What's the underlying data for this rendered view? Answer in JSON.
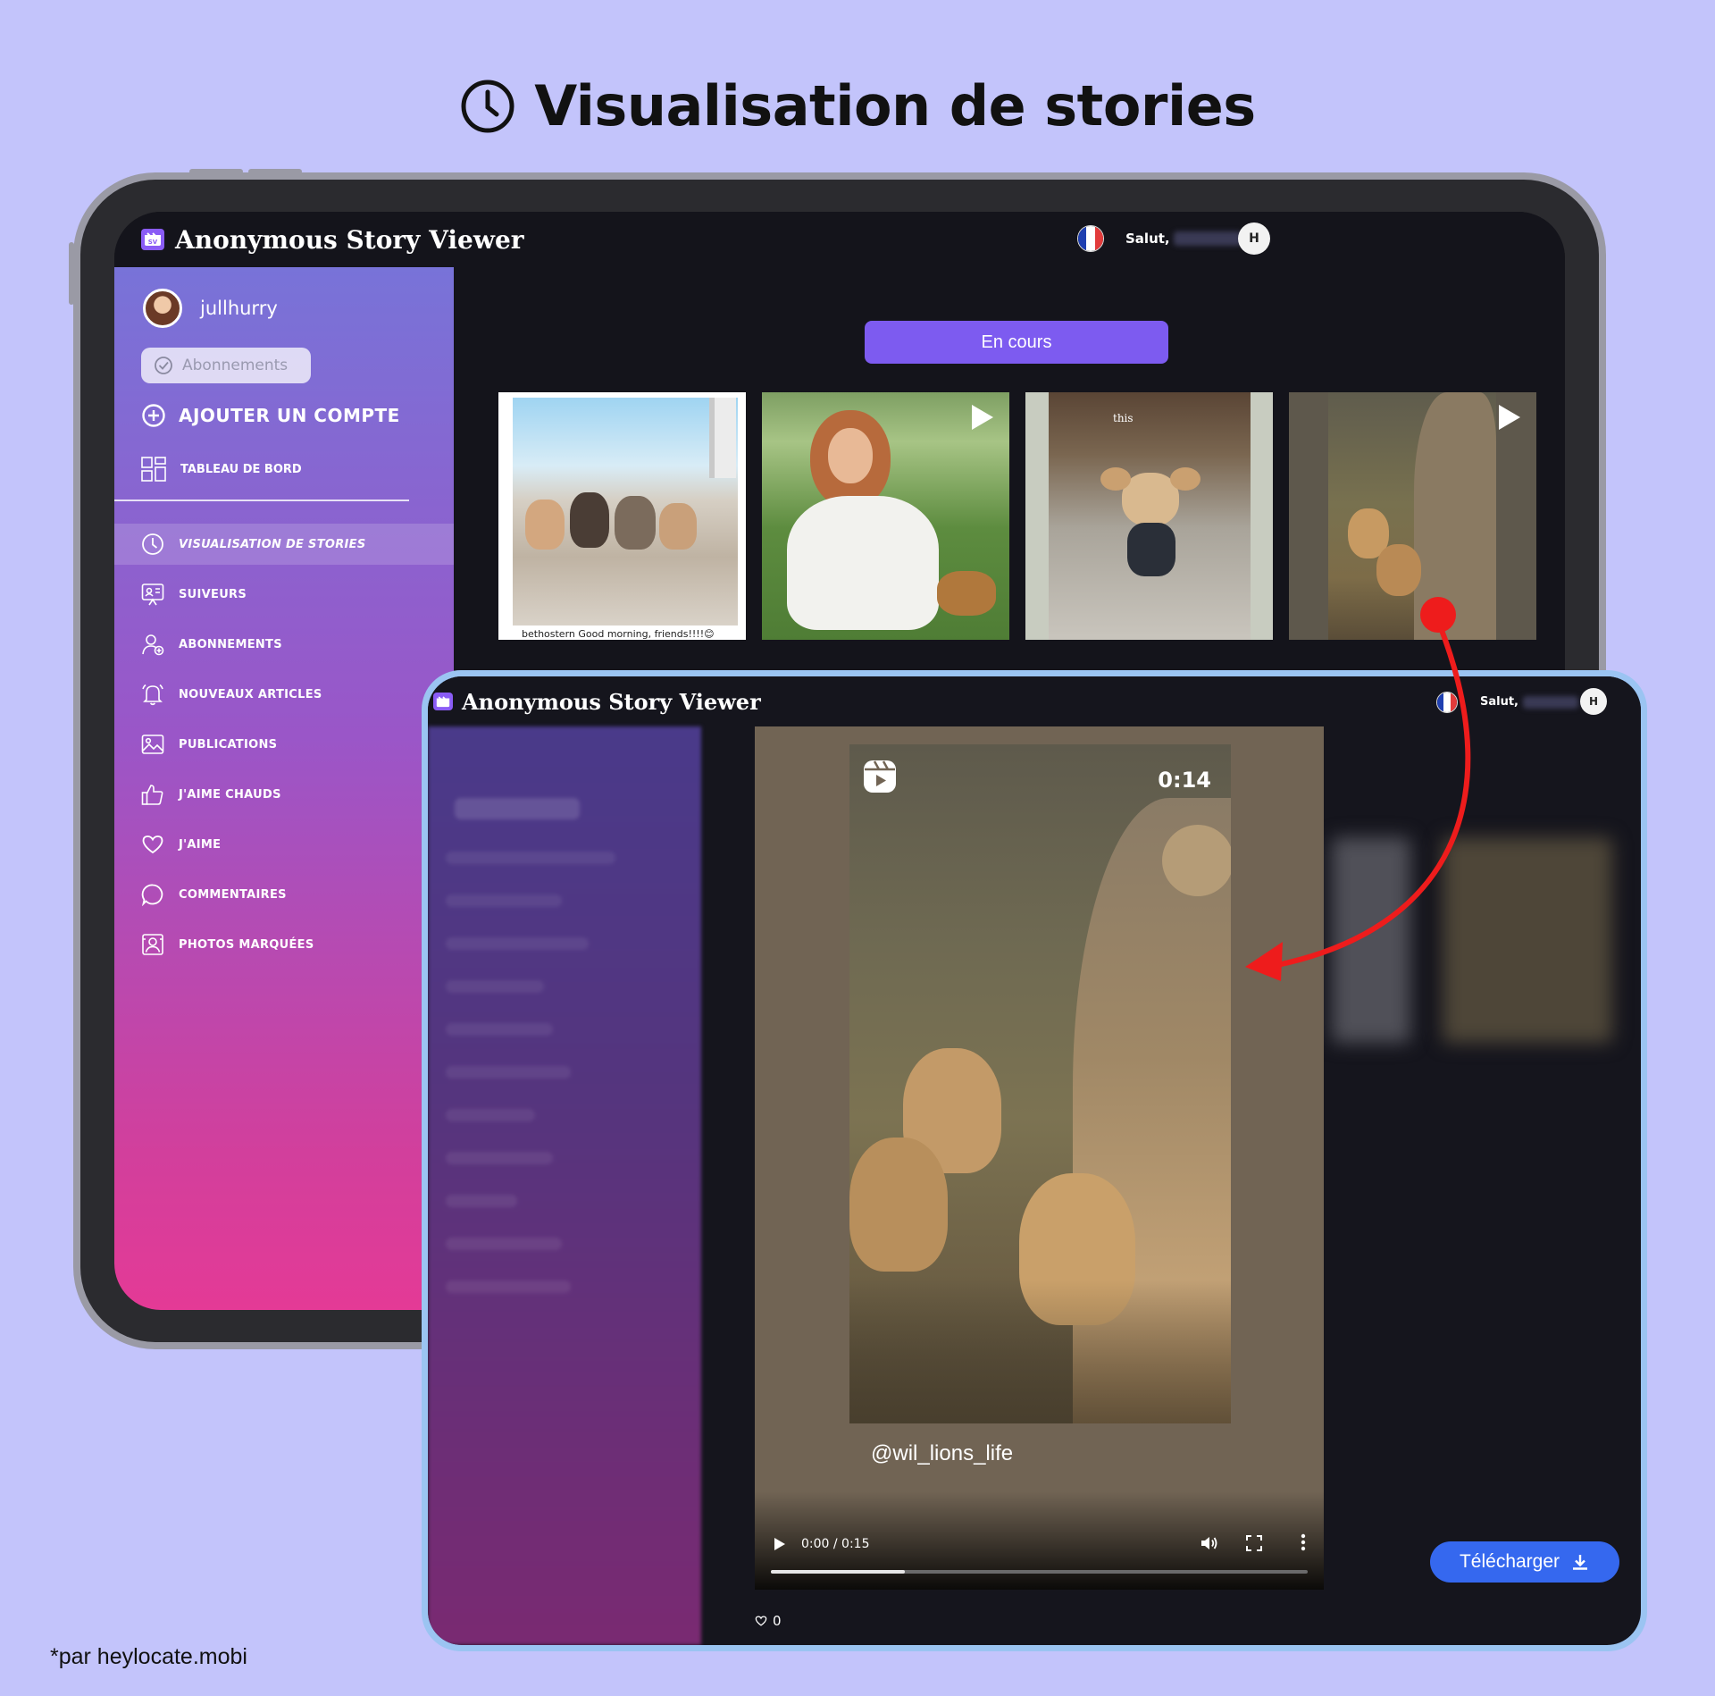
{
  "headline": {
    "title": "Visualisation de stories"
  },
  "footer": {
    "note": "*par heylocate.mobi"
  },
  "app": {
    "title": "Anonymous Story Viewer",
    "logo_text": "SV",
    "greeting": "Salut,",
    "avatar_initial": "H",
    "flag_colors": [
      "#1f3fb0",
      "#ffffff",
      "#e23b3b"
    ],
    "accent_color": "#7d5bf0"
  },
  "sidebar": {
    "username": "jullhurry",
    "subs_pill": "Abonnements",
    "add_account": "AJOUTER UN COMPTE",
    "dashboard": "TABLEAU DE BORD",
    "items": [
      {
        "label": "VISUALISATION DE STORIES",
        "icon": "clock-icon",
        "active": true
      },
      {
        "label": "SUIVEURS",
        "icon": "followers-icon"
      },
      {
        "label": "ABONNEMENTS",
        "icon": "user-plus-icon"
      },
      {
        "label": "NOUVEAUX ARTICLES",
        "icon": "bell-icon"
      },
      {
        "label": "PUBLICATIONS",
        "icon": "image-icon"
      },
      {
        "label": "J'AIME CHAUDS",
        "icon": "thumbs-up-icon"
      },
      {
        "label": "J'AIME",
        "icon": "heart-icon"
      },
      {
        "label": "COMMENTAIRES",
        "icon": "comment-icon"
      },
      {
        "label": "PHOTOS MARQUÉES",
        "icon": "tagged-photo-icon"
      }
    ]
  },
  "main": {
    "tab_label": "En cours",
    "thumbnails": [
      {
        "name": "kittens-thumb",
        "caption": "bethostern Good morning, friends!!!!😊",
        "has_play": false
      },
      {
        "name": "woman-picnic-thumb",
        "caption": "",
        "has_play": true
      },
      {
        "name": "dog-thumb",
        "caption": "this",
        "has_play": false
      },
      {
        "name": "lions-thumb",
        "caption": "",
        "has_play": true
      }
    ]
  },
  "viewer": {
    "elapsed_label": "0:14",
    "handle": "@wil_lions_life",
    "time_display": "0:00 / 0:15",
    "progress": 0.25,
    "likes": "0",
    "download_label": "Télécharger"
  }
}
